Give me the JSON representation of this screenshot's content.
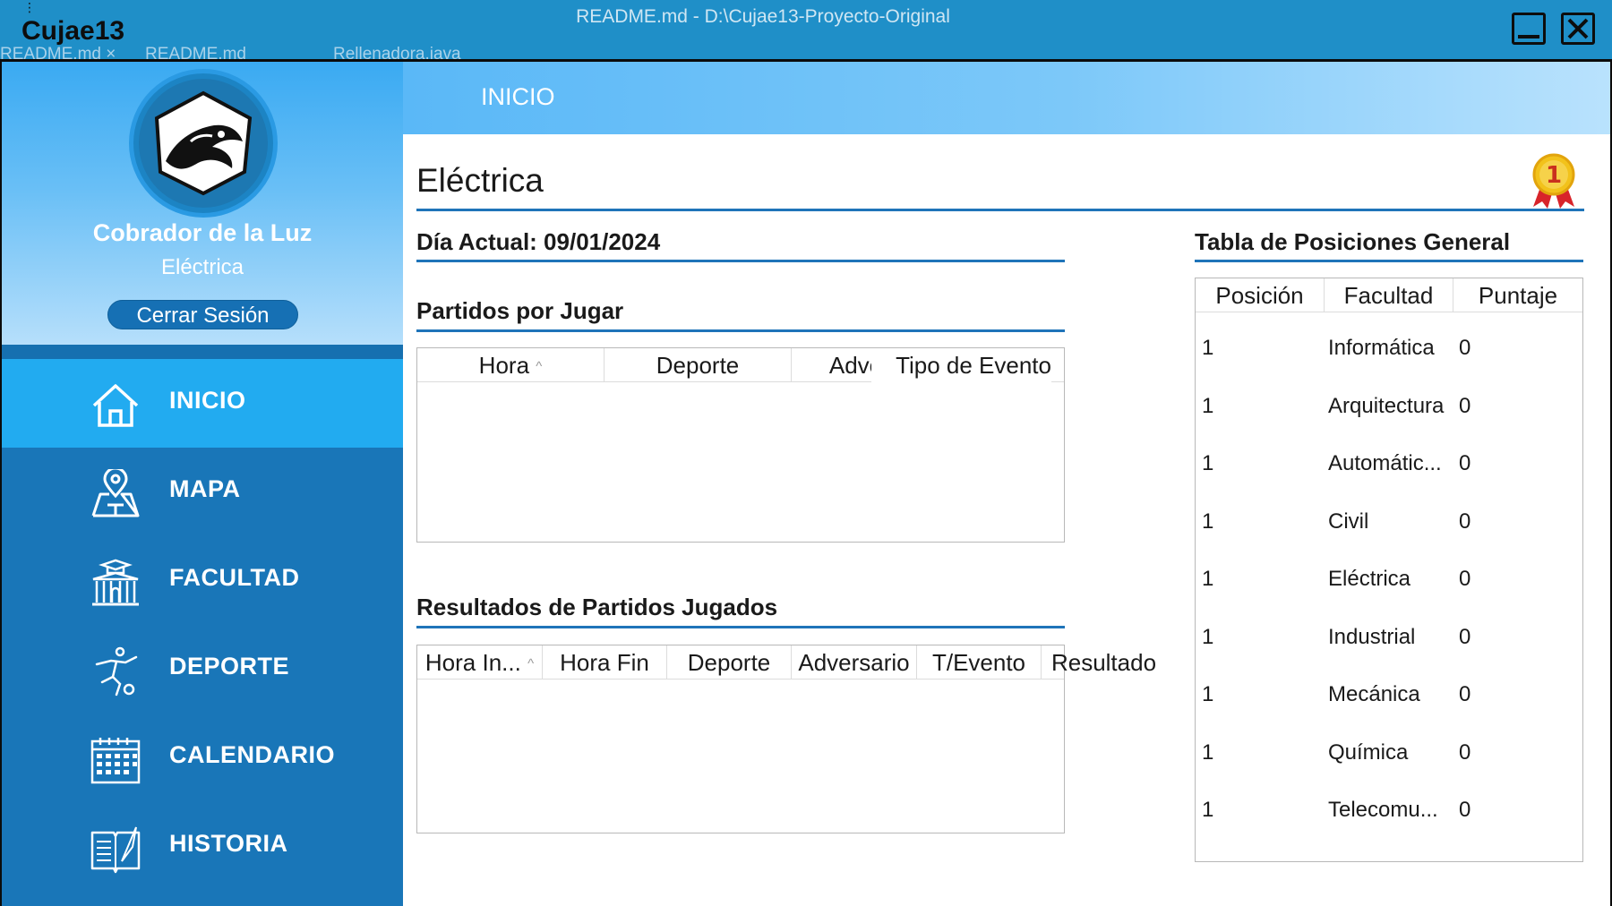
{
  "window": {
    "title": "README.md - D:\\Cujae13-Proyecto-Original",
    "app_title": "Cujae13",
    "tabs": [
      "README.md ×",
      "README.md",
      "Rellenadora.java"
    ]
  },
  "sidebar": {
    "user_name": "Cobrador de la Luz",
    "user_faculty": "Eléctrica",
    "logout_label": "Cerrar Sesión",
    "items": [
      {
        "label": "INICIO",
        "icon": "home-icon",
        "active": true
      },
      {
        "label": "MAPA",
        "icon": "map-icon",
        "active": false
      },
      {
        "label": "FACULTAD",
        "icon": "faculty-building-icon",
        "active": false
      },
      {
        "label": "DEPORTE",
        "icon": "sport-player-icon",
        "active": false
      },
      {
        "label": "CALENDARIO",
        "icon": "calendar-icon",
        "active": false
      },
      {
        "label": "HISTORIA",
        "icon": "history-book-icon",
        "active": false
      }
    ]
  },
  "header": {
    "title": "INICIO"
  },
  "main": {
    "faculty_title": "Eléctrica",
    "medal_rank": "1",
    "current_day": "Día Actual: 09/01/2024",
    "upcoming": {
      "title": "Partidos por Jugar",
      "columns": [
        "Hora",
        "Deporte",
        "Adversario",
        "Tipo de Evento"
      ],
      "rows": []
    },
    "results": {
      "title": "Resultados de Partidos Jugados",
      "columns": [
        "Hora In...",
        "Hora Fin",
        "Deporte",
        "Adversario",
        "T/Evento",
        "Resultado"
      ],
      "rows": []
    },
    "standings": {
      "title": "Tabla de Posiciones General",
      "columns": [
        "Posición",
        "Facultad",
        "Puntaje"
      ],
      "rows": [
        {
          "pos": "1",
          "faculty": "Informática",
          "score": "0"
        },
        {
          "pos": "1",
          "faculty": "Arquitectura",
          "score": "0"
        },
        {
          "pos": "1",
          "faculty": "Automátic...",
          "score": "0"
        },
        {
          "pos": "1",
          "faculty": "Civil",
          "score": "0"
        },
        {
          "pos": "1",
          "faculty": "Eléctrica",
          "score": "0"
        },
        {
          "pos": "1",
          "faculty": "Industrial",
          "score": "0"
        },
        {
          "pos": "1",
          "faculty": "Mecánica",
          "score": "0"
        },
        {
          "pos": "1",
          "faculty": "Química",
          "score": "0"
        },
        {
          "pos": "1",
          "faculty": "Telecomu...",
          "score": "0"
        }
      ]
    }
  },
  "colors": {
    "sidebar": "#1976b8",
    "active_item": "#22abf0",
    "accent_rule": "#1f74b9",
    "header_gradient_start": "#5ab8f7"
  }
}
